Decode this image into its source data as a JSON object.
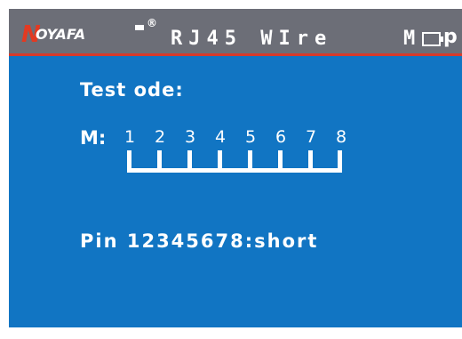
{
  "header": {
    "logo": {
      "first_letter": "N",
      "rest": "OYAFA",
      "registered": "®"
    },
    "title": "RJ45 WIre",
    "right_glyph": "M",
    "right_text": "p"
  },
  "screen": {
    "mode_label": "Test  ode:",
    "m_label": "M:",
    "pins": [
      "1",
      "2",
      "3",
      "4",
      "5",
      "6",
      "7",
      "8"
    ],
    "result": "Pin 12345678:short"
  },
  "colors": {
    "header_bg": "#6c6e77",
    "screen_bg": "#1175c3",
    "accent_red": "#d83a2a",
    "text": "#ffffff"
  },
  "icons": {
    "battery": "battery-icon",
    "logo": "noyafa-logo"
  }
}
